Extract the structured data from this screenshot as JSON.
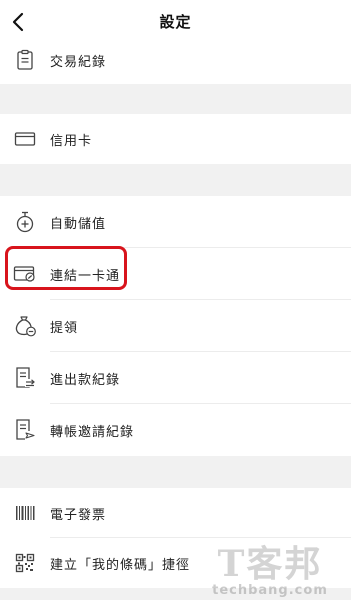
{
  "header": {
    "title": "設定",
    "back_icon": "chevron-left-icon"
  },
  "menu": {
    "transactions": {
      "label": "交易紀錄",
      "icon": "clipboard-icon"
    },
    "credit_card": {
      "label": "信用卡",
      "icon": "credit-card-icon"
    },
    "auto_topup": {
      "label": "自動儲值",
      "icon": "plus-coin-icon"
    },
    "link_ipass": {
      "label": "連結一卡通",
      "icon": "link-card-icon",
      "highlighted": true
    },
    "withdraw": {
      "label": "提領",
      "icon": "money-bag-minus-icon"
    },
    "inout_records": {
      "label": "進出款紀錄",
      "icon": "receipt-arrow-icon"
    },
    "transfer_invites": {
      "label": "轉帳邀請紀錄",
      "icon": "receipt-send-icon"
    },
    "einvoice": {
      "label": "電子發票",
      "icon": "barcode-icon"
    },
    "barcode_shortcut": {
      "label": "建立「我的條碼」捷徑",
      "icon": "qr-code-icon"
    }
  },
  "watermark": {
    "logo": "T客邦",
    "url": "techbang.com"
  },
  "colors": {
    "highlight": "#d8141c",
    "section_gap": "#f1f1f1",
    "divider": "#ececec"
  }
}
